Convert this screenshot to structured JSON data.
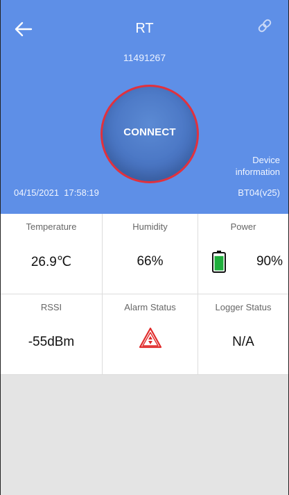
{
  "header": {
    "title": "RT",
    "serial": "11491267",
    "connect_label": "CONNECT",
    "device_info_line1": "Device",
    "device_info_line2": "information",
    "datetime": "04/15/2021  17:58:19",
    "firmware": "BT04(v25)"
  },
  "stats": {
    "temperature": {
      "label": "Temperature",
      "value": "26.9℃"
    },
    "humidity": {
      "label": "Humidity",
      "value": "66%"
    },
    "power": {
      "label": "Power",
      "value": "90%",
      "level": 0.9
    },
    "rssi": {
      "label": "RSSI",
      "value": "-55dBm"
    },
    "alarm": {
      "label": "Alarm Status",
      "icon": "alarm-warning-icon"
    },
    "logger": {
      "label": "Logger Status",
      "value": "N/A"
    }
  },
  "colors": {
    "header_bg": "#5e8fe7",
    "connect_ring": "#e1313d",
    "battery_green": "#1fae3c",
    "alarm_red": "#e02a2a"
  }
}
